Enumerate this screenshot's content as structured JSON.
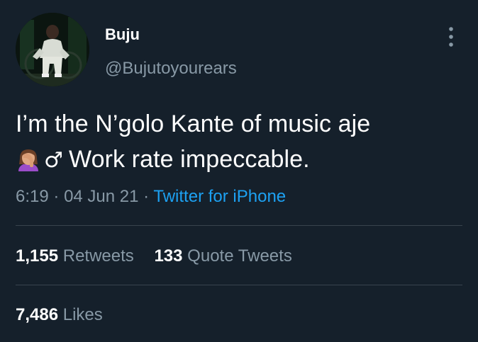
{
  "author": {
    "name": "Buju",
    "handle": "@Bujutoyourears"
  },
  "tweet": {
    "line1": "I’m the N’golo Kante of music aje",
    "line2_emoji": "woman-facepalming-icon",
    "line2_sign": "♂",
    "line2_text": "Work rate impeccable."
  },
  "meta": {
    "time": "6:19",
    "date": "04 Jun 21",
    "separator": "·",
    "source": "Twitter for iPhone"
  },
  "stats": {
    "retweets_count": "1,155",
    "retweets_label": "Retweets",
    "quotes_count": "133",
    "quotes_label": "Quote Tweets",
    "likes_count": "7,486",
    "likes_label": "Likes"
  },
  "colors": {
    "background": "#15202b",
    "text": "#ffffff",
    "muted": "#8899a6",
    "link": "#1da1f2",
    "divider": "#38444d"
  }
}
